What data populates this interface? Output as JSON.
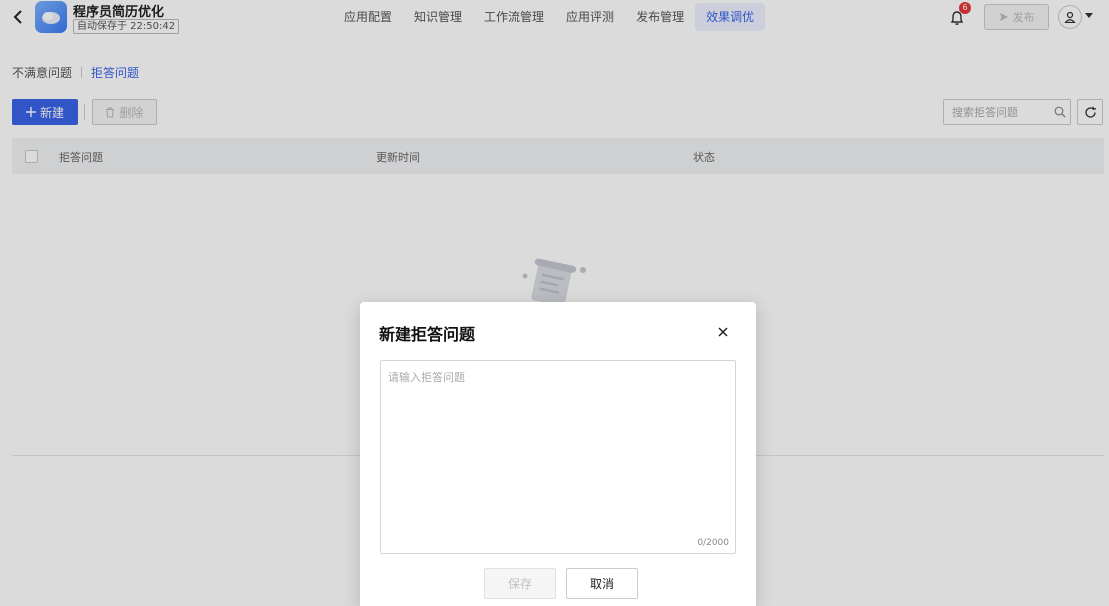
{
  "header": {
    "app_title": "程序员简历优化",
    "autosave": "自动保存于 22:50:42",
    "nav": [
      {
        "label": "应用配置"
      },
      {
        "label": "知识管理"
      },
      {
        "label": "工作流管理"
      },
      {
        "label": "应用评测"
      },
      {
        "label": "发布管理"
      },
      {
        "label": "效果调优",
        "active": true
      }
    ],
    "notification_count": "6",
    "publish_label": "发布"
  },
  "breadcrumb": {
    "items": [
      "不满意问题",
      "拒答问题"
    ]
  },
  "toolbar": {
    "new_label": "新建",
    "delete_label": "删除",
    "search_placeholder": "搜索拒答问题"
  },
  "table": {
    "columns": [
      "拒答问题",
      "更新时间",
      "状态"
    ],
    "rows": []
  },
  "modal": {
    "title": "新建拒答问题",
    "placeholder": "请输入拒答问题",
    "counter": "0/2000",
    "save_label": "保存",
    "cancel_label": "取消"
  },
  "colors": {
    "accent": "#3a62e8",
    "badge": "#e53935"
  }
}
